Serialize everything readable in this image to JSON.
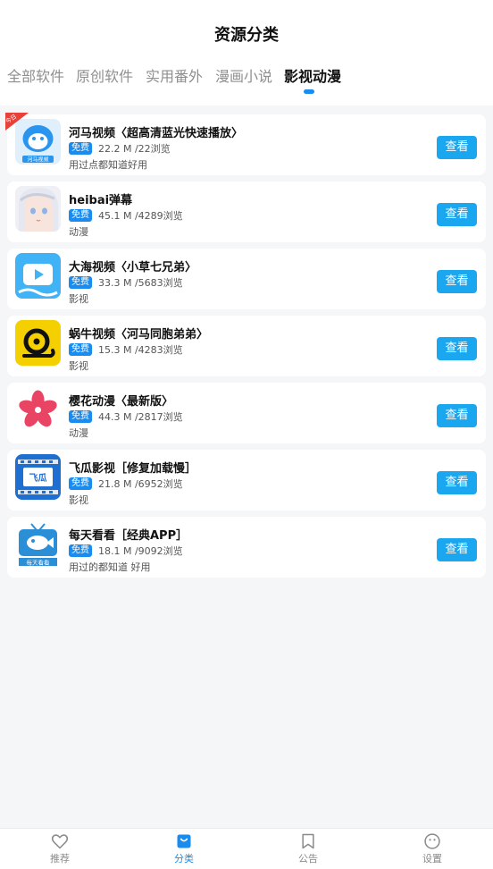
{
  "header": {
    "title": "资源分类"
  },
  "tabs": [
    {
      "label": "全部软件"
    },
    {
      "label": "原创软件"
    },
    {
      "label": "实用番外"
    },
    {
      "label": "漫画小说"
    },
    {
      "label": "影视动漫"
    }
  ],
  "free_badge": "免费",
  "view_label": "查看",
  "corner_tag": "今日",
  "items": [
    {
      "name": "河马视频〈超高清蓝光快速播放〉",
      "meta": "22.2 M /22浏览",
      "desc": "用过点都知道好用",
      "icon_text": "河马视频"
    },
    {
      "name": "heibai弹幕",
      "meta": "45.1 M /4289浏览",
      "desc": "动漫"
    },
    {
      "name": "大海视频〈小草七兄弟〉",
      "meta": "33.3 M /5683浏览",
      "desc": "影视"
    },
    {
      "name": "蜗牛视频〈河马同胞弟弟〉",
      "meta": "15.3 M /4283浏览",
      "desc": "影视"
    },
    {
      "name": "樱花动漫〈最新版〉",
      "meta": "44.3 M /2817浏览",
      "desc": "动漫"
    },
    {
      "name": "飞瓜影视［修复加载慢］",
      "meta": "21.8 M /6952浏览",
      "desc": "影视",
      "icon_text": "飞瓜"
    },
    {
      "name": "每天看看［经典APP］",
      "meta": "18.1 M /9092浏览",
      "desc": "用过的都知道 好用",
      "icon_text": "每天看看"
    }
  ],
  "bottom_nav": [
    {
      "label": "推荐"
    },
    {
      "label": "分类"
    },
    {
      "label": "公告"
    },
    {
      "label": "设置"
    }
  ],
  "colors": {
    "accent": "#1a8cf0",
    "button": "#1aa7f0"
  }
}
